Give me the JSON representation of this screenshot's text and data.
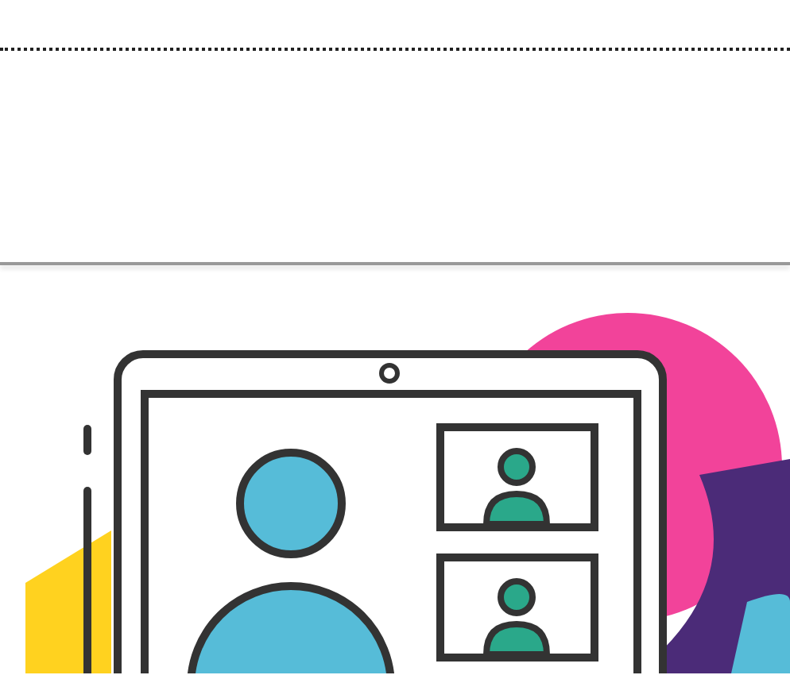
{
  "illustration": {
    "kind": "video-call"
  }
}
